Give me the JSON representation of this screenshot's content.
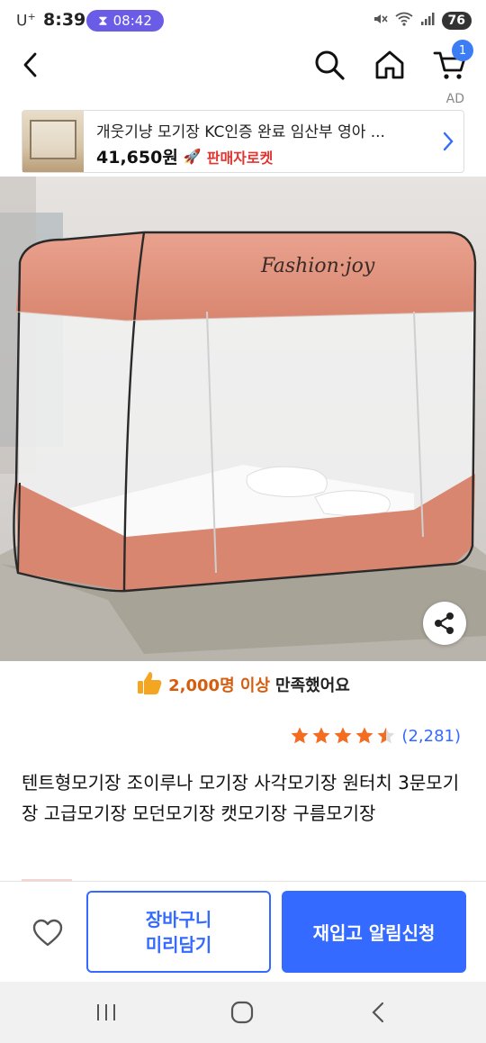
{
  "status_bar": {
    "carrier": "U",
    "carrier_sup": "+",
    "time": "8:39",
    "timer": "08:42",
    "battery": "76"
  },
  "nav": {
    "back_icon": "chevron-left-icon",
    "search_icon": "search-icon",
    "home_icon": "home-icon",
    "cart_icon": "cart-icon",
    "cart_badge": "1"
  },
  "ad": {
    "label": "AD",
    "title": "개웃기냥 모기장 KC인증 완료 임산부 영아 ...",
    "price": "41,650원",
    "seller_badge": "판매자로켓"
  },
  "satisfaction": {
    "count": "2,000명 이상",
    "text": "만족했어요"
  },
  "rating": {
    "stars": 4.5,
    "count": "(2,281)"
  },
  "product": {
    "title": "텐트형모기장 조이루나 모기장 사각모기장 원터치 3문모기장 고급모기장 모던모기장 캣모기장 구름모기장"
  },
  "actions": {
    "cart_line1": "장바구니",
    "cart_line2": "미리담기",
    "restock": "재입고 알림신청"
  },
  "colors": {
    "accent": "#346aff",
    "satisfaction": "#d65d0e",
    "star": "#f26d21"
  }
}
